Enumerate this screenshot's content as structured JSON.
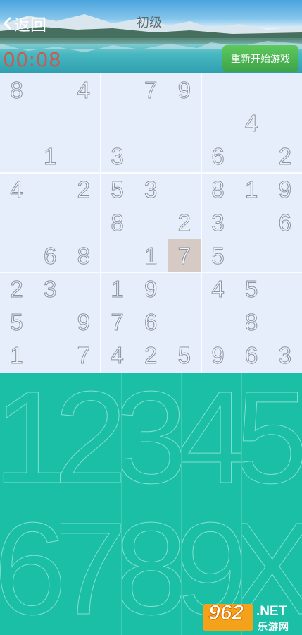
{
  "header": {
    "back_label": "返回",
    "level": "初级",
    "timer": "00:08",
    "restart_label": "重新开始游戏"
  },
  "board": {
    "rows": [
      [
        "8",
        "",
        "4",
        "",
        "7",
        "9",
        "",
        "",
        ""
      ],
      [
        "",
        "",
        "",
        "",
        "",
        "",
        "",
        "4",
        ""
      ],
      [
        "",
        "1",
        "",
        "3",
        "",
        "",
        "6",
        "",
        "2"
      ],
      [
        "4",
        "",
        "2",
        "5",
        "3",
        "",
        "8",
        "1",
        "9"
      ],
      [
        "",
        "",
        "",
        "8",
        "",
        "2",
        "3",
        "",
        "6"
      ],
      [
        "",
        "6",
        "8",
        "",
        "1",
        "7",
        "5",
        "",
        ""
      ],
      [
        "2",
        "3",
        "",
        "1",
        "9",
        "",
        "4",
        "5",
        ""
      ],
      [
        "5",
        "",
        "9",
        "7",
        "6",
        "",
        "",
        "8",
        ""
      ],
      [
        "1",
        "",
        "7",
        "4",
        "2",
        "5",
        "9",
        "6",
        "3"
      ]
    ],
    "selected": {
      "row": 5,
      "col": 5
    }
  },
  "keypad": {
    "keys": [
      "1",
      "2",
      "3",
      "4",
      "5",
      "6",
      "7",
      "8",
      "9",
      "X"
    ]
  },
  "watermark": {
    "logo_number": "962",
    "logo_suffix": ".NET",
    "site_name": "乐游网"
  }
}
